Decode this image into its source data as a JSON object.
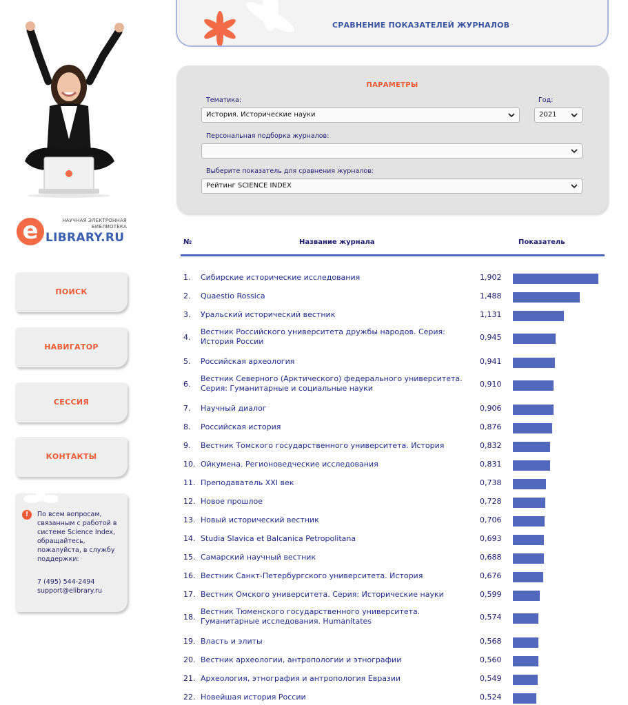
{
  "header": {
    "title": "СРАВНЕНИЕ ПОКАЗАТЕЛЕЙ ЖУРНАЛОВ"
  },
  "logo": {
    "tagline_line1": "НАУЧНАЯ ЭЛЕКТРОННАЯ",
    "tagline_line2": "БИБЛИОТЕКА",
    "mark": "e",
    "brand": "LIBRARY.RU"
  },
  "nav": {
    "search": "ПОИСК",
    "navigator": "НАВИГАТОР",
    "session": "СЕССИЯ",
    "contacts": "КОНТАКТЫ"
  },
  "support": {
    "text": "По всем вопросам, связанным с работой в системе Science Index, обращайтесь, пожалуйста, в службу поддержки:",
    "phone": "7 (495) 544-2494",
    "email": "support@elibrary.ru"
  },
  "params": {
    "title": "ПАРАМЕТРЫ",
    "topic_label": "Тематика:",
    "topic_value": "История. Исторические науки",
    "year_label": "Год:",
    "year_value": "2021",
    "personal_label": "Персональная подборка журналов:",
    "personal_value": "",
    "indicator_label": "Выберите показатель для сравнения журналов:",
    "indicator_value": "Рейтинг SCIENCE INDEX"
  },
  "table": {
    "col_num": "№",
    "col_name": "Название журнала",
    "col_value": "Показатель",
    "bar_color": "#5168bd",
    "rows": [
      {
        "num": "1.",
        "name": "Сибирские исторические исследования",
        "value": "1,902",
        "score": 1.902
      },
      {
        "num": "2.",
        "name": "Quaestio Rossica",
        "value": "1,488",
        "score": 1.488
      },
      {
        "num": "3.",
        "name": "Уральский исторический вестник",
        "value": "1,131",
        "score": 1.131
      },
      {
        "num": "4.",
        "name": "Вестник Российского университета дружбы народов. Серия: История России",
        "value": "0,945",
        "score": 0.945
      },
      {
        "num": "5.",
        "name": "Российская археология",
        "value": "0,941",
        "score": 0.941
      },
      {
        "num": "6.",
        "name": "Вестник Северного (Арктического) федерального университета. Серия: Гуманитарные и социальные науки",
        "value": "0,910",
        "score": 0.91
      },
      {
        "num": "7.",
        "name": "Научный диалог",
        "value": "0,906",
        "score": 0.906
      },
      {
        "num": "8.",
        "name": "Российская история",
        "value": "0,876",
        "score": 0.876
      },
      {
        "num": "9.",
        "name": "Вестник Томского государственного университета. История",
        "value": "0,832",
        "score": 0.832
      },
      {
        "num": "10.",
        "name": "Ойкумена. Регионоведческие исследования",
        "value": "0,831",
        "score": 0.831
      },
      {
        "num": "11.",
        "name": "Преподаватель XXI век",
        "value": "0,738",
        "score": 0.738
      },
      {
        "num": "12.",
        "name": "Новое прошлое",
        "value": "0,728",
        "score": 0.728
      },
      {
        "num": "13.",
        "name": "Новый исторический вестник",
        "value": "0,706",
        "score": 0.706
      },
      {
        "num": "14.",
        "name": "Studia Slavica et Balcanica Petropolitana",
        "value": "0,693",
        "score": 0.693
      },
      {
        "num": "15.",
        "name": "Самарский научный вестник",
        "value": "0,688",
        "score": 0.688
      },
      {
        "num": "16.",
        "name": "Вестник Санкт-Петербургского университета. История",
        "value": "0,676",
        "score": 0.676
      },
      {
        "num": "17.",
        "name": "Вестник Омского университета. Серия: Исторические науки",
        "value": "0,599",
        "score": 0.599
      },
      {
        "num": "18.",
        "name": "Вестник Тюменского государственного университета. Гуманитарные исследования. Humanitates",
        "value": "0,574",
        "score": 0.574
      },
      {
        "num": "19.",
        "name": "Власть и элиты",
        "value": "0,568",
        "score": 0.568
      },
      {
        "num": "20.",
        "name": "Вестник археологии, антропологии и этнографии",
        "value": "0,560",
        "score": 0.56
      },
      {
        "num": "21.",
        "name": "Археология, этнография и антропология Евразии",
        "value": "0,549",
        "score": 0.549
      },
      {
        "num": "22.",
        "name": "Новейшая история России",
        "value": "0,524",
        "score": 0.524
      }
    ]
  }
}
